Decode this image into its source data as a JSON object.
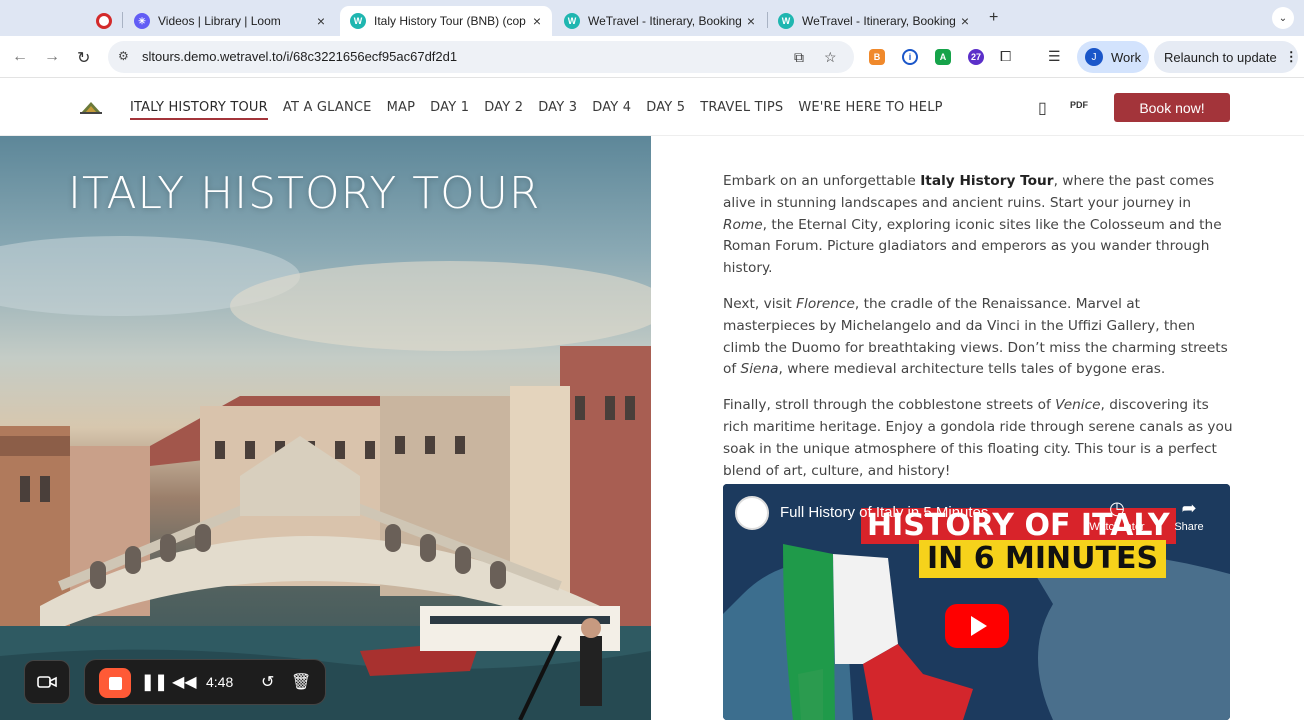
{
  "browser": {
    "tabs": [
      {
        "title": "",
        "favicon": "loom-record-icon",
        "active": false
      },
      {
        "title": "Videos | Library | Loom",
        "favicon": "loom-icon",
        "active": false
      },
      {
        "title": "Italy History Tour (BNB) (cop",
        "favicon": "wetravel-icon",
        "active": true
      },
      {
        "title": "WeTravel - Itinerary, Booking",
        "favicon": "wetravel-icon",
        "active": false
      },
      {
        "title": "WeTravel - Itinerary, Booking",
        "favicon": "wetravel-icon",
        "active": false
      }
    ],
    "url": "sltours.demo.wetravel.to/i/68c3221656ecf95ac67df2d1",
    "profile_initial": "J",
    "profile_label": "Work",
    "relaunch_label": "Relaunch to update",
    "extension_badge": "27"
  },
  "site": {
    "nav": [
      "ITALY HISTORY TOUR",
      "AT A GLANCE",
      "MAP",
      "DAY 1",
      "DAY 2",
      "DAY 3",
      "DAY 4",
      "DAY 5",
      "TRAVEL TIPS",
      "WE'RE HERE TO HELP"
    ],
    "pdf_label": "PDF",
    "book_label": "Book now!",
    "accent": "#a3343a"
  },
  "hero": {
    "title": "ITALY HISTORY TOUR"
  },
  "content": {
    "p1": {
      "a": "Embark on an unforgettable ",
      "b": "Italy History Tour",
      "c": ", where the past comes alive in stunning landscapes and ancient ruins. Start your journey in ",
      "d": "Rome",
      "e": ", the Eternal City, exploring iconic sites like the Colosseum and the Roman Forum. Picture gladiators and emperors as you wander through history."
    },
    "p2": {
      "a": "Next, visit ",
      "b": "Florence",
      "c": ", the cradle of the Renaissance. Marvel at masterpieces by Michelangelo and da Vinci in the Uffizi Gallery, then climb the Duomo for breathtaking views. Don’t miss the charming streets of ",
      "d": "Siena",
      "e": ", where medieval architecture tells tales of bygone eras."
    },
    "p3": {
      "a": "Finally, stroll through the cobblestone streets of ",
      "b": "Venice",
      "c": ", discovering its rich maritime heritage. Enjoy a gondola ride through serene canals as you soak in the unique atmosphere of this floating city. This tour is a perfect blend of art, culture, and history!"
    }
  },
  "video": {
    "title": "Full History of Italy in 5 Minutes",
    "thumb_line1": "HISTORY OF ITALY",
    "thumb_line2": "IN 6 MINUTES",
    "watch_later": "Watch later",
    "share": "Share"
  },
  "recorder": {
    "time": "4:48"
  }
}
